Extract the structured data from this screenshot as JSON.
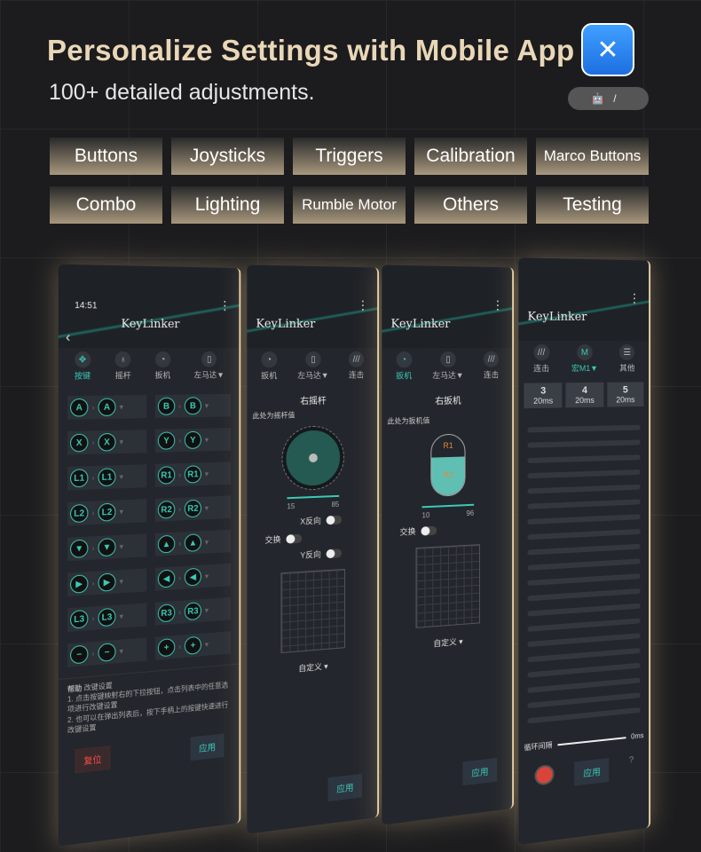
{
  "header": {
    "title": "Personalize Settings with Mobile App",
    "subtitle": "100+ detailed adjustments.",
    "os_badges": [
      "android-icon",
      "apple-icon"
    ],
    "os_separator": "/"
  },
  "categories": [
    "Buttons",
    "Joysticks",
    "Triggers",
    "Calibration",
    "Marco Buttons",
    "Combo",
    "Lighting",
    "Rumble Motor",
    "Others",
    "Testing"
  ],
  "app": {
    "name": "KeyLinker",
    "time": "14:51",
    "tabs": [
      "按键",
      "摇杆",
      "扳机",
      "左马达▼",
      "连击",
      "宏M1▼",
      "其他"
    ],
    "buttons_left": [
      [
        "A",
        "A"
      ],
      [
        "X",
        "X"
      ],
      [
        "L1",
        "L1"
      ],
      [
        "L2",
        "L2"
      ],
      [
        "▼",
        "▼"
      ],
      [
        "▶",
        "▶"
      ],
      [
        "L3",
        "L3"
      ],
      [
        "−",
        "−"
      ]
    ],
    "buttons_right": [
      [
        "B",
        "B"
      ],
      [
        "Y",
        "Y"
      ],
      [
        "R1",
        "R1"
      ],
      [
        "R2",
        "R2"
      ],
      [
        "▲",
        "▲"
      ],
      [
        "◀",
        "◀"
      ],
      [
        "R3",
        "R3"
      ],
      [
        "+",
        "+"
      ]
    ],
    "help_label": "帮助",
    "help_title": "改键设置",
    "help_1": "1. 点击按键映射右的下拉按钮，点击列表中的任意选项进行改键设置",
    "help_2": "2. 也可以在弹出列表后，按下手柄上的按键快速进行改键设置",
    "reset": "复位",
    "apply": "应用",
    "stick": {
      "title": "右摇杆",
      "hint": "此处为摇杆值",
      "min": "15",
      "max": "85",
      "x_invert": "X反向",
      "y_invert": "Y反向",
      "swap": "交换",
      "curve": "自定义 ▾"
    },
    "trigger": {
      "title": "右扳机",
      "hint": "此处为扳机值",
      "r1": "R1",
      "r2": "R2",
      "min": "10",
      "max": "96",
      "swap": "交换",
      "curve": "自定义 ▾"
    },
    "macro": {
      "steps": [
        {
          "n": "3",
          "t": "20ms"
        },
        {
          "n": "4",
          "t": "20ms"
        },
        {
          "n": "5",
          "t": "20ms"
        }
      ],
      "loop_label": "循环间隔",
      "loop_value": "0ms",
      "help": "?"
    }
  },
  "colors": {
    "accent": "#3cc9b6",
    "title": "#ead7b8",
    "reset": "#ff4a4a"
  }
}
